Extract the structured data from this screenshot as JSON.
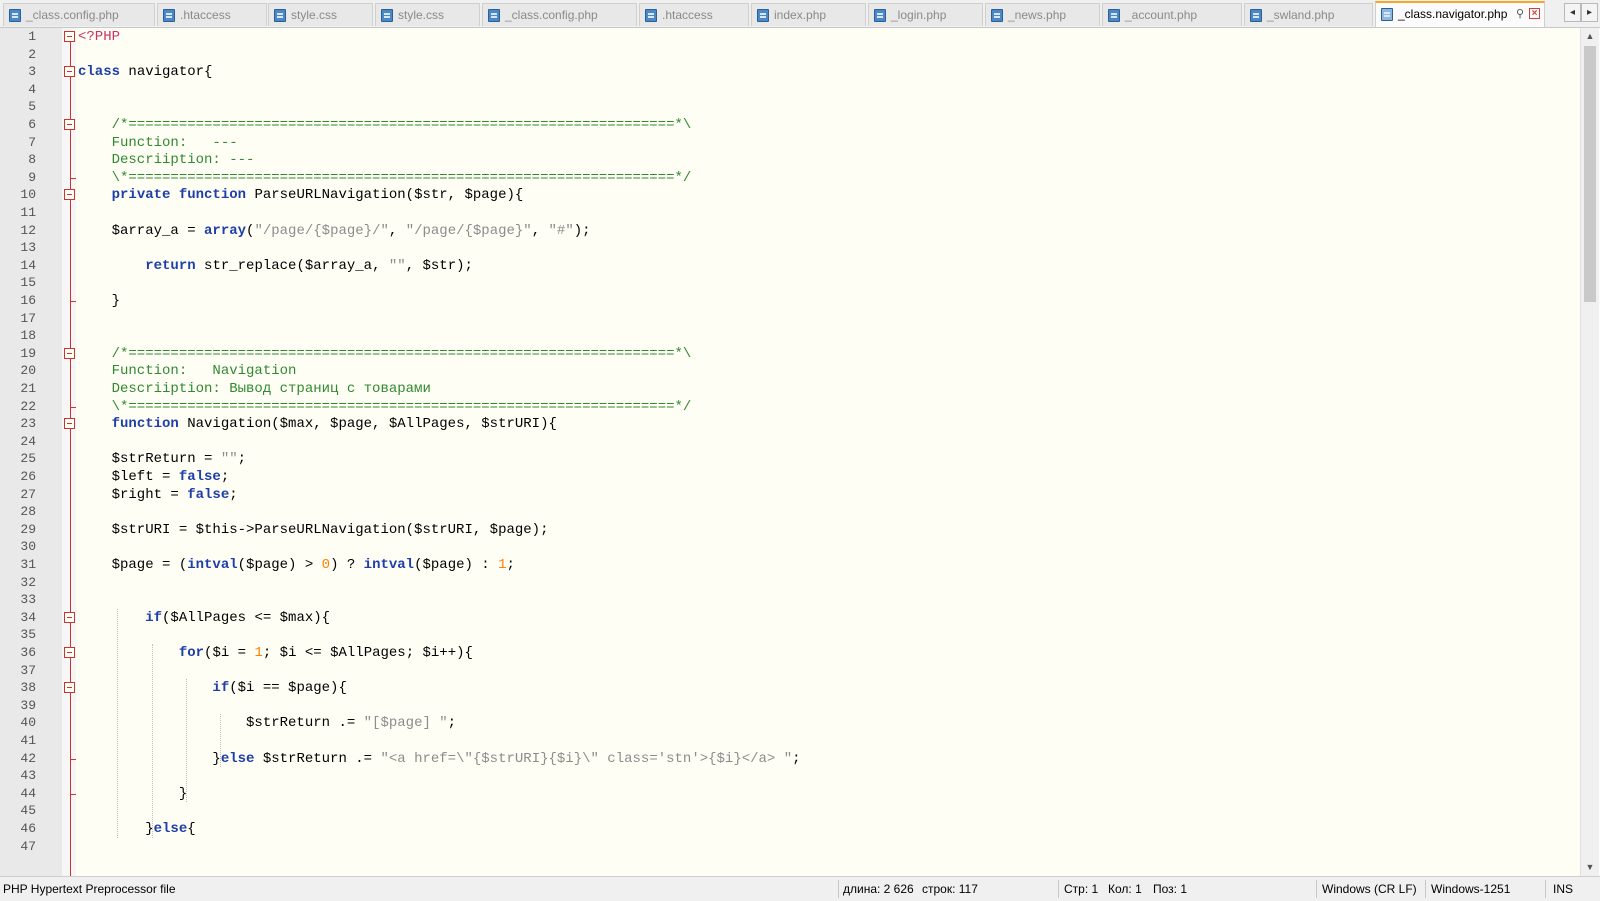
{
  "tabs": [
    {
      "label": "_class.config.php",
      "active": false
    },
    {
      "label": ".htaccess",
      "active": false
    },
    {
      "label": "style.css",
      "active": false
    },
    {
      "label": "style.css",
      "active": false
    },
    {
      "label": "_class.config.php",
      "active": false
    },
    {
      "label": ".htaccess",
      "active": false
    },
    {
      "label": "index.php",
      "active": false
    },
    {
      "label": "_login.php",
      "active": false
    },
    {
      "label": "_news.php",
      "active": false
    },
    {
      "label": "_account.php",
      "active": false
    },
    {
      "label": "_swland.php",
      "active": false
    },
    {
      "label": "_class.navigator.php",
      "active": true
    }
  ],
  "tab_nav": {
    "prev": "◂",
    "next": "▸"
  },
  "code_lines": [
    {
      "n": "1",
      "text": "<?PHP"
    },
    {
      "n": "2",
      "text": ""
    },
    {
      "n": "3",
      "text": "class navigator{"
    },
    {
      "n": "4",
      "text": ""
    },
    {
      "n": "5",
      "text": ""
    },
    {
      "n": "6",
      "text": "    /*=================================================================*\\"
    },
    {
      "n": "7",
      "text": "    Function:   ---"
    },
    {
      "n": "8",
      "text": "    Descriiption: ---"
    },
    {
      "n": "9",
      "text": "    \\*=================================================================*/"
    },
    {
      "n": "10",
      "text": "    private function ParseURLNavigation($str, $page){"
    },
    {
      "n": "11",
      "text": ""
    },
    {
      "n": "12",
      "text": "    $array_a = array(\"/page/{$page}/\", \"/page/{$page}\", \"#\");"
    },
    {
      "n": "13",
      "text": ""
    },
    {
      "n": "14",
      "text": "        return str_replace($array_a, \"\", $str);"
    },
    {
      "n": "15",
      "text": ""
    },
    {
      "n": "16",
      "text": "    }"
    },
    {
      "n": "17",
      "text": ""
    },
    {
      "n": "18",
      "text": ""
    },
    {
      "n": "19",
      "text": "    /*=================================================================*\\"
    },
    {
      "n": "20",
      "text": "    Function:   Navigation"
    },
    {
      "n": "21",
      "text": "    Descriiption: Вывод страниц с товарами"
    },
    {
      "n": "22",
      "text": "    \\*=================================================================*/"
    },
    {
      "n": "23",
      "text": "    function Navigation($max, $page, $AllPages, $strURI){"
    },
    {
      "n": "24",
      "text": ""
    },
    {
      "n": "25",
      "text": "    $strReturn = \"\";"
    },
    {
      "n": "26",
      "text": "    $left = false;"
    },
    {
      "n": "27",
      "text": "    $right = false;"
    },
    {
      "n": "28",
      "text": ""
    },
    {
      "n": "29",
      "text": "    $strURI = $this->ParseURLNavigation($strURI, $page);"
    },
    {
      "n": "30",
      "text": ""
    },
    {
      "n": "31",
      "text": "    $page = (intval($page) > 0) ? intval($page) : 1;"
    },
    {
      "n": "32",
      "text": ""
    },
    {
      "n": "33",
      "text": ""
    },
    {
      "n": "34",
      "text": "        if($AllPages <= $max){"
    },
    {
      "n": "35",
      "text": ""
    },
    {
      "n": "36",
      "text": "            for($i = 1; $i <= $AllPages; $i++){"
    },
    {
      "n": "37",
      "text": ""
    },
    {
      "n": "38",
      "text": "                if($i == $page){"
    },
    {
      "n": "39",
      "text": ""
    },
    {
      "n": "40",
      "text": "                    $strReturn .= \"[$page] \";"
    },
    {
      "n": "41",
      "text": ""
    },
    {
      "n": "42",
      "text": "                }else $strReturn .= \"<a href=\\\"{$strURI}{$i}\\\" class='stn'>{$i}</a> \";"
    },
    {
      "n": "43",
      "text": ""
    },
    {
      "n": "44",
      "text": "            }"
    },
    {
      "n": "45",
      "text": ""
    },
    {
      "n": "46",
      "text": "        }else{"
    },
    {
      "n": "47",
      "text": ""
    }
  ],
  "status": {
    "file_type": "PHP Hypertext Preprocessor file",
    "length": "длина: 2 626",
    "lines": "строк: 117",
    "row": "Стр: 1",
    "col": "Кол: 1",
    "pos": "Поз: 1",
    "eol": "Windows (CR LF)",
    "encoding": "Windows-1251",
    "mode": "INS"
  },
  "colors": {
    "editor_bg": "#fffef5",
    "keyword": "#1e3ea8",
    "comment": "#2f8a2f",
    "string": "#8c8c8c",
    "number": "#ff8000",
    "active_tab_accent": "#f3a928"
  }
}
